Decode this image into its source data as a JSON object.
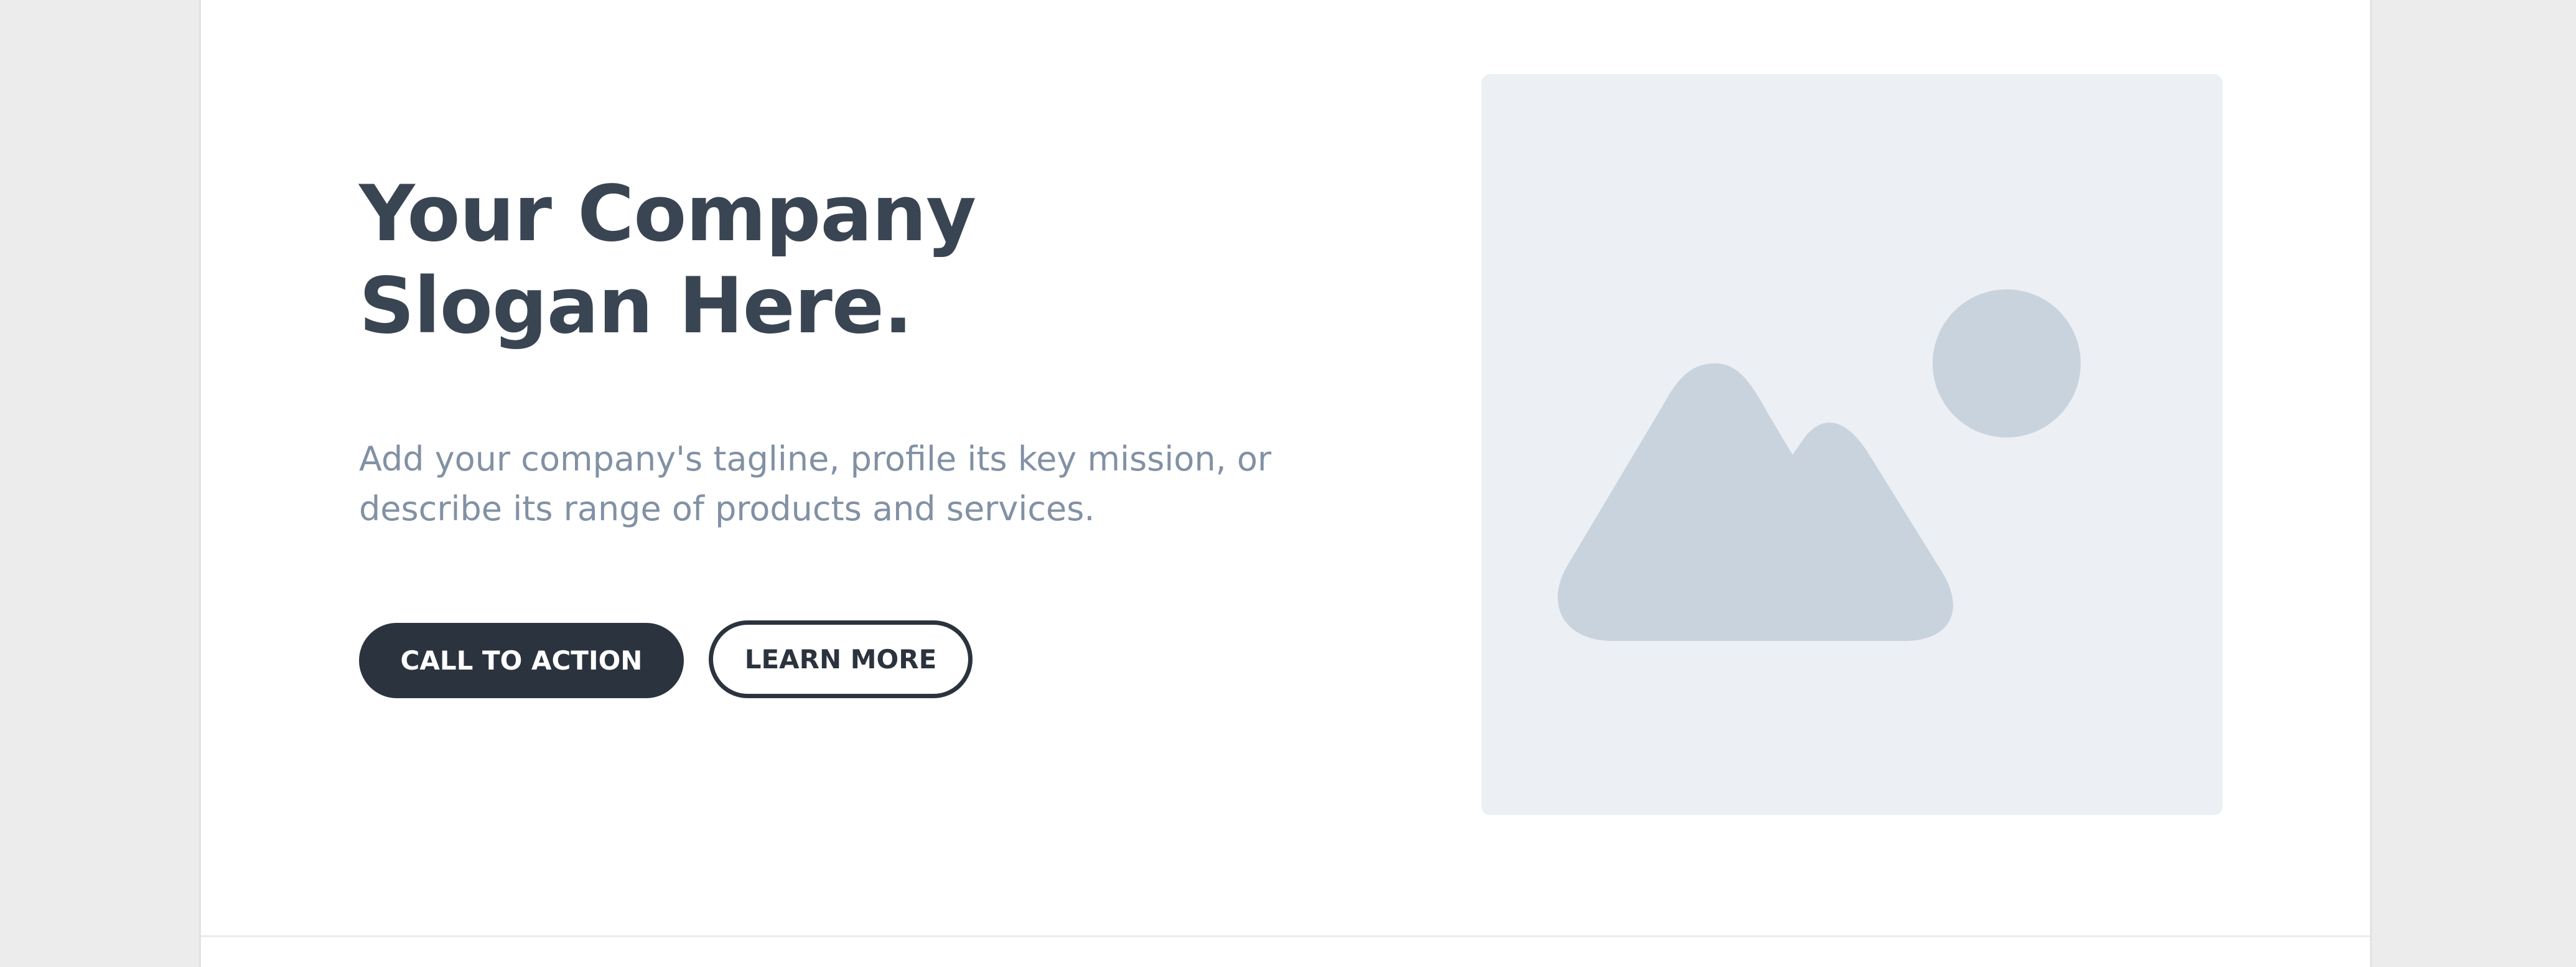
{
  "hero": {
    "title_line1": "Your Company",
    "title_line2": "Slogan Here.",
    "tagline_line1": "Add your company's tagline, profile its key mission, or",
    "tagline_line2": "describe its range of products and services."
  },
  "buttons": {
    "primary_label": "CALL TO ACTION",
    "secondary_label": "LEARN MORE"
  },
  "image_placeholder": {
    "icon": "image-icon"
  },
  "colors": {
    "page_background": "#ececec",
    "card_background": "#ffffff",
    "heading": "#3a4553",
    "tagline": "#8291a4",
    "button_dark": "#2b333e",
    "placeholder_bg": "#eceff3",
    "placeholder_icon": "#c9d3dd"
  }
}
